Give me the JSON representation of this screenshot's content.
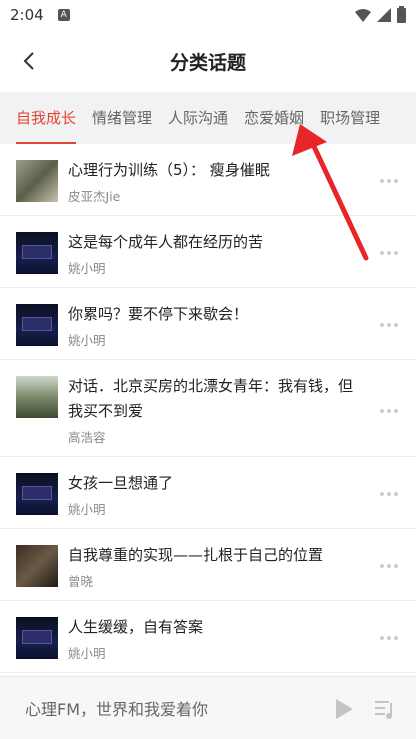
{
  "status": {
    "time": "2:04",
    "notification": "A"
  },
  "header": {
    "title": "分类话题"
  },
  "tabs": [
    {
      "label": "自我成长",
      "active": true
    },
    {
      "label": "情绪管理",
      "active": false
    },
    {
      "label": "人际沟通",
      "active": false
    },
    {
      "label": "恋爱婚姻",
      "active": false
    },
    {
      "label": "职场管理",
      "active": false
    }
  ],
  "items": [
    {
      "title": "心理行为训练（5）： 瘦身催眠",
      "author": "皮亚杰Jie",
      "thumb": "photo"
    },
    {
      "title": "这是每个成年人都在经历的苦",
      "author": "姚小明",
      "thumb": "stage"
    },
    {
      "title": "你累吗？要不停下来歇会！",
      "author": "姚小明",
      "thumb": "stage"
    },
    {
      "title": " 对话．北京买房的北漂女青年：我有钱，但我买不到爱",
      "author": "高浩容",
      "thumb": "portrait"
    },
    {
      "title": "女孩一旦想通了",
      "author": "姚小明",
      "thumb": "stage"
    },
    {
      "title": "自我尊重的实现——扎根于自己的位置",
      "author": "曾晓",
      "thumb": "studio"
    },
    {
      "title": "人生缓缓，自有答案",
      "author": "姚小明",
      "thumb": "stage"
    }
  ],
  "player": {
    "title": "心理FM，世界和我爱着你"
  },
  "colors": {
    "accent": "#e4453a",
    "arrow": "#e8262a"
  }
}
